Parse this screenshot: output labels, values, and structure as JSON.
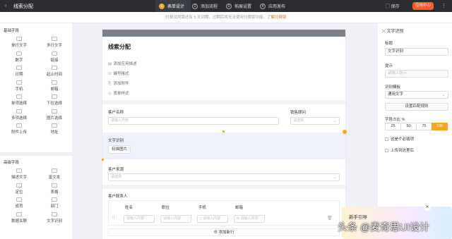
{
  "topbar": {
    "title": "线索分配",
    "steps": [
      {
        "num": "1",
        "label": "表单设计"
      },
      {
        "num": "2",
        "label": "添加流程"
      },
      {
        "num": "3",
        "label": "拓展设置"
      },
      {
        "num": "4",
        "label": "应用发布"
      }
    ],
    "save_label": "保存",
    "app_center_label": "应用中心"
  },
  "notice": {
    "text": "付费试用版还有 5 天到期，过期后将无法使用付费版功能，",
    "link": "了解付费版"
  },
  "left": {
    "basic_title": "基础字段",
    "basic": [
      "单行文字",
      "多行文字",
      "数字",
      "链接",
      "日期",
      "起止时间",
      "手机",
      "邮箱",
      "单项选择",
      "下拉选择",
      "多项选择",
      "图片选择",
      "附件上传",
      "地址"
    ],
    "advanced_title": "高级字段",
    "advanced": [
      "描述文字",
      "富文本",
      "定位",
      "表格",
      "成员",
      "部门",
      "数据关联",
      "文字识别"
    ]
  },
  "form": {
    "title": "线索分配",
    "options": [
      "添加应用描述",
      "编号格式",
      "添加附件",
      "表单样式"
    ],
    "customer_name_label": "客户名称",
    "customer_name_placeholder": "请输入内容",
    "sales_label": "销售顾问",
    "sales_placeholder": "请选择",
    "ocr_label": "文字识别",
    "ocr_button": "扫描图片",
    "source_label": "客户来源",
    "source_placeholder": "请选择",
    "contact_label": "客户联系人",
    "columns": [
      "姓名",
      "职位",
      "手机",
      "邮箱"
    ],
    "cell_placeholder": "请输入内容",
    "add_row": "添加新行"
  },
  "right": {
    "header": "文字识别",
    "title_label": "标题",
    "title_value": "文字识别",
    "hint_label": "提示",
    "hint_placeholder": "请输入提示",
    "template_label": "识别模板",
    "template_value": "通用文字",
    "match_button": "设置匹配规则",
    "width_label": "字段占比 %",
    "width_options": [
      "25",
      "50",
      "75",
      "100"
    ],
    "required_label": "这是个必填项",
    "upload_label": "上传到这里后"
  },
  "guide": {
    "title": "新手引导"
  },
  "watermark": "头条 @麦奇思UI设计"
}
